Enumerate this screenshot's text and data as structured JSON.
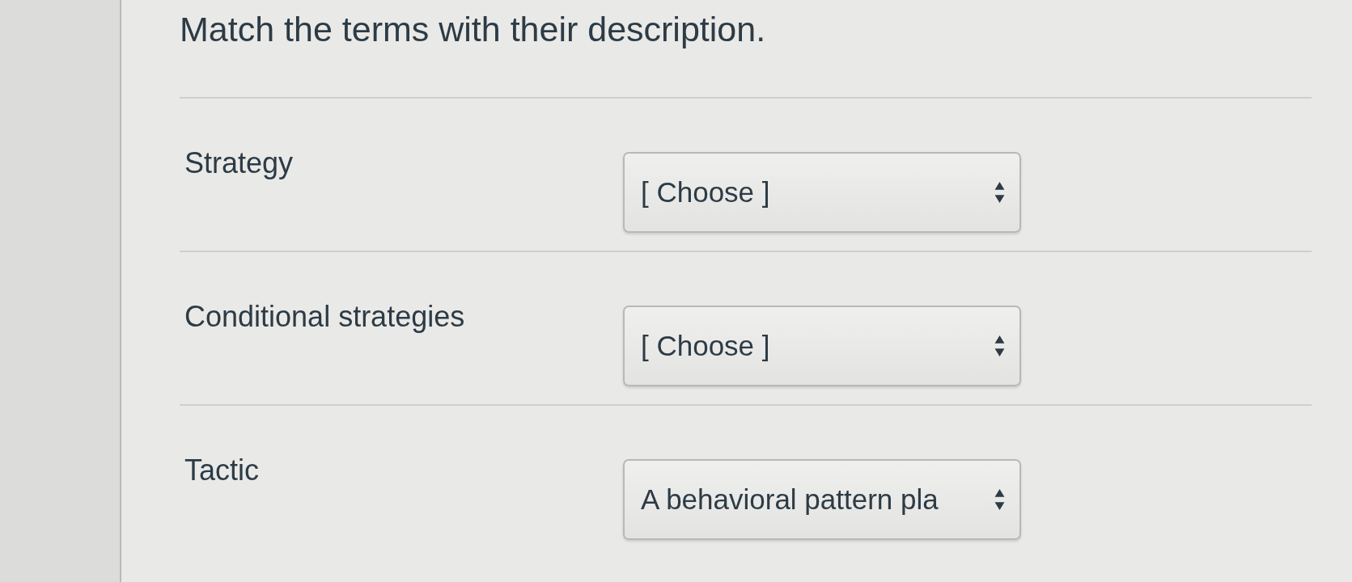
{
  "title": "Match the terms with their description.",
  "items": [
    {
      "term": "Strategy",
      "answer": "[ Choose ]"
    },
    {
      "term": "Conditional strategies",
      "answer": "[ Choose ]"
    },
    {
      "term": "Tactic",
      "answer": "A behavioral pattern pla"
    }
  ]
}
